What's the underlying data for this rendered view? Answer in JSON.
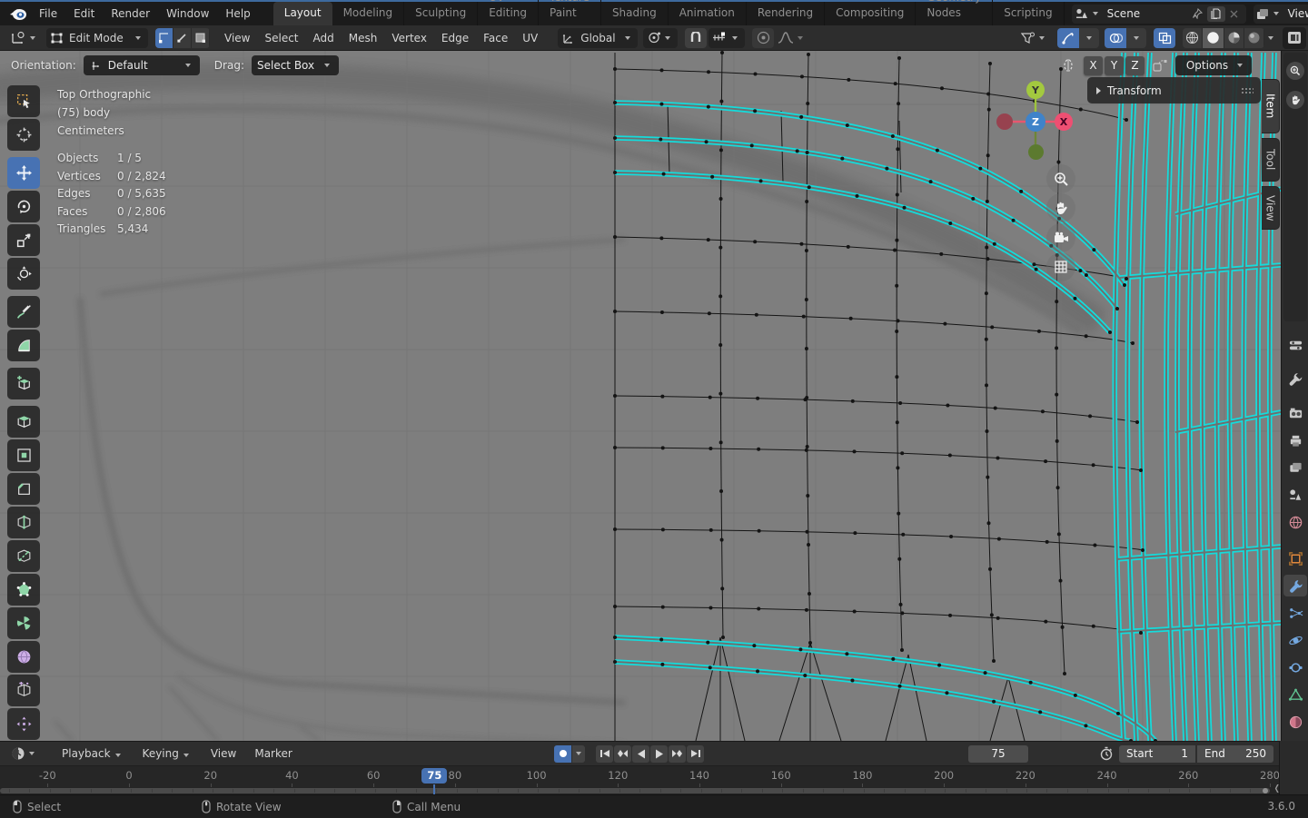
{
  "topbar": {
    "menus": [
      "File",
      "Edit",
      "Render",
      "Window",
      "Help"
    ],
    "workspaces": [
      "Layout",
      "Modeling",
      "Sculpting",
      "UV Editing",
      "Texture Paint",
      "Shading",
      "Animation",
      "Rendering",
      "Compositing",
      "Geometry Nodes",
      "Scripting"
    ],
    "active_workspace": "Layout",
    "scene_name": "Scene",
    "view_layer_name": "ViewLayer"
  },
  "viewport_header": {
    "mode": "Edit Mode",
    "menus": [
      "View",
      "Select",
      "Add",
      "Mesh",
      "Vertex",
      "Edge",
      "Face",
      "UV"
    ],
    "orientation": "Global"
  },
  "tool_settings": {
    "orientation_label": "Orientation:",
    "orientation_value": "Default",
    "drag_label": "Drag:",
    "drag_value": "Select Box",
    "axes": [
      "X",
      "Y",
      "Z"
    ],
    "options_label": "Options"
  },
  "toolbar_tools": [
    {
      "name": "select-box",
      "active": false,
      "group_start": false
    },
    {
      "name": "cursor",
      "active": false,
      "group_start": false
    },
    {
      "name": "move",
      "active": true,
      "group_start": true
    },
    {
      "name": "rotate",
      "active": false,
      "group_start": false
    },
    {
      "name": "scale",
      "active": false,
      "group_start": false
    },
    {
      "name": "transform",
      "active": false,
      "group_start": false
    },
    {
      "name": "annotate",
      "active": false,
      "group_start": true
    },
    {
      "name": "measure",
      "active": false,
      "group_start": false
    },
    {
      "name": "add-cube",
      "active": false,
      "group_start": true
    },
    {
      "name": "extrude-region",
      "active": false,
      "group_start": true
    },
    {
      "name": "inset-faces",
      "active": false,
      "group_start": false
    },
    {
      "name": "bevel",
      "active": false,
      "group_start": false
    },
    {
      "name": "loop-cut",
      "active": false,
      "group_start": false
    },
    {
      "name": "knife",
      "active": false,
      "group_start": false
    },
    {
      "name": "poly-build",
      "active": false,
      "group_start": false
    },
    {
      "name": "spin",
      "active": false,
      "group_start": false
    },
    {
      "name": "smooth",
      "active": false,
      "group_start": false
    },
    {
      "name": "edge-slide",
      "active": false,
      "group_start": false
    },
    {
      "name": "shrink-fatten",
      "active": false,
      "group_start": false
    }
  ],
  "overlay": {
    "view": "Top Orthographic",
    "object": "(75) body",
    "units": "Centimeters",
    "stats": [
      {
        "label": "Objects",
        "value": "1 / 5"
      },
      {
        "label": "Vertices",
        "value": "0 / 2,824"
      },
      {
        "label": "Edges",
        "value": "0 / 5,635"
      },
      {
        "label": "Faces",
        "value": "0 / 2,806"
      },
      {
        "label": "Triangles",
        "value": "5,434"
      }
    ]
  },
  "gizmo": {
    "axis_top": "Y",
    "axis_center": "Z",
    "axis_right": "X"
  },
  "sidebar": {
    "panel_title": "Transform",
    "tabs": [
      "Item",
      "Tool",
      "View"
    ],
    "active_tab": "Item"
  },
  "properties_tabs": [
    "tool",
    "render",
    "output",
    "view-layer",
    "scene",
    "world",
    "object",
    "modifiers",
    "particles",
    "physics",
    "constraints",
    "object-data",
    "material"
  ],
  "properties_active_tab": "modifiers",
  "timeline": {
    "menus": [
      "Playback",
      "Keying",
      "View",
      "Marker"
    ],
    "frame_field": "75",
    "start_label": "Start",
    "start_value": "1",
    "end_label": "End",
    "end_value": "250",
    "ticks": [
      -20,
      0,
      20,
      40,
      60,
      80,
      100,
      120,
      140,
      160,
      180,
      200,
      220,
      240,
      260,
      280
    ],
    "playhead_frame": 75
  },
  "status": {
    "hints": [
      "Select",
      "Rotate View",
      "Call Menu"
    ],
    "version": "3.6.0"
  }
}
